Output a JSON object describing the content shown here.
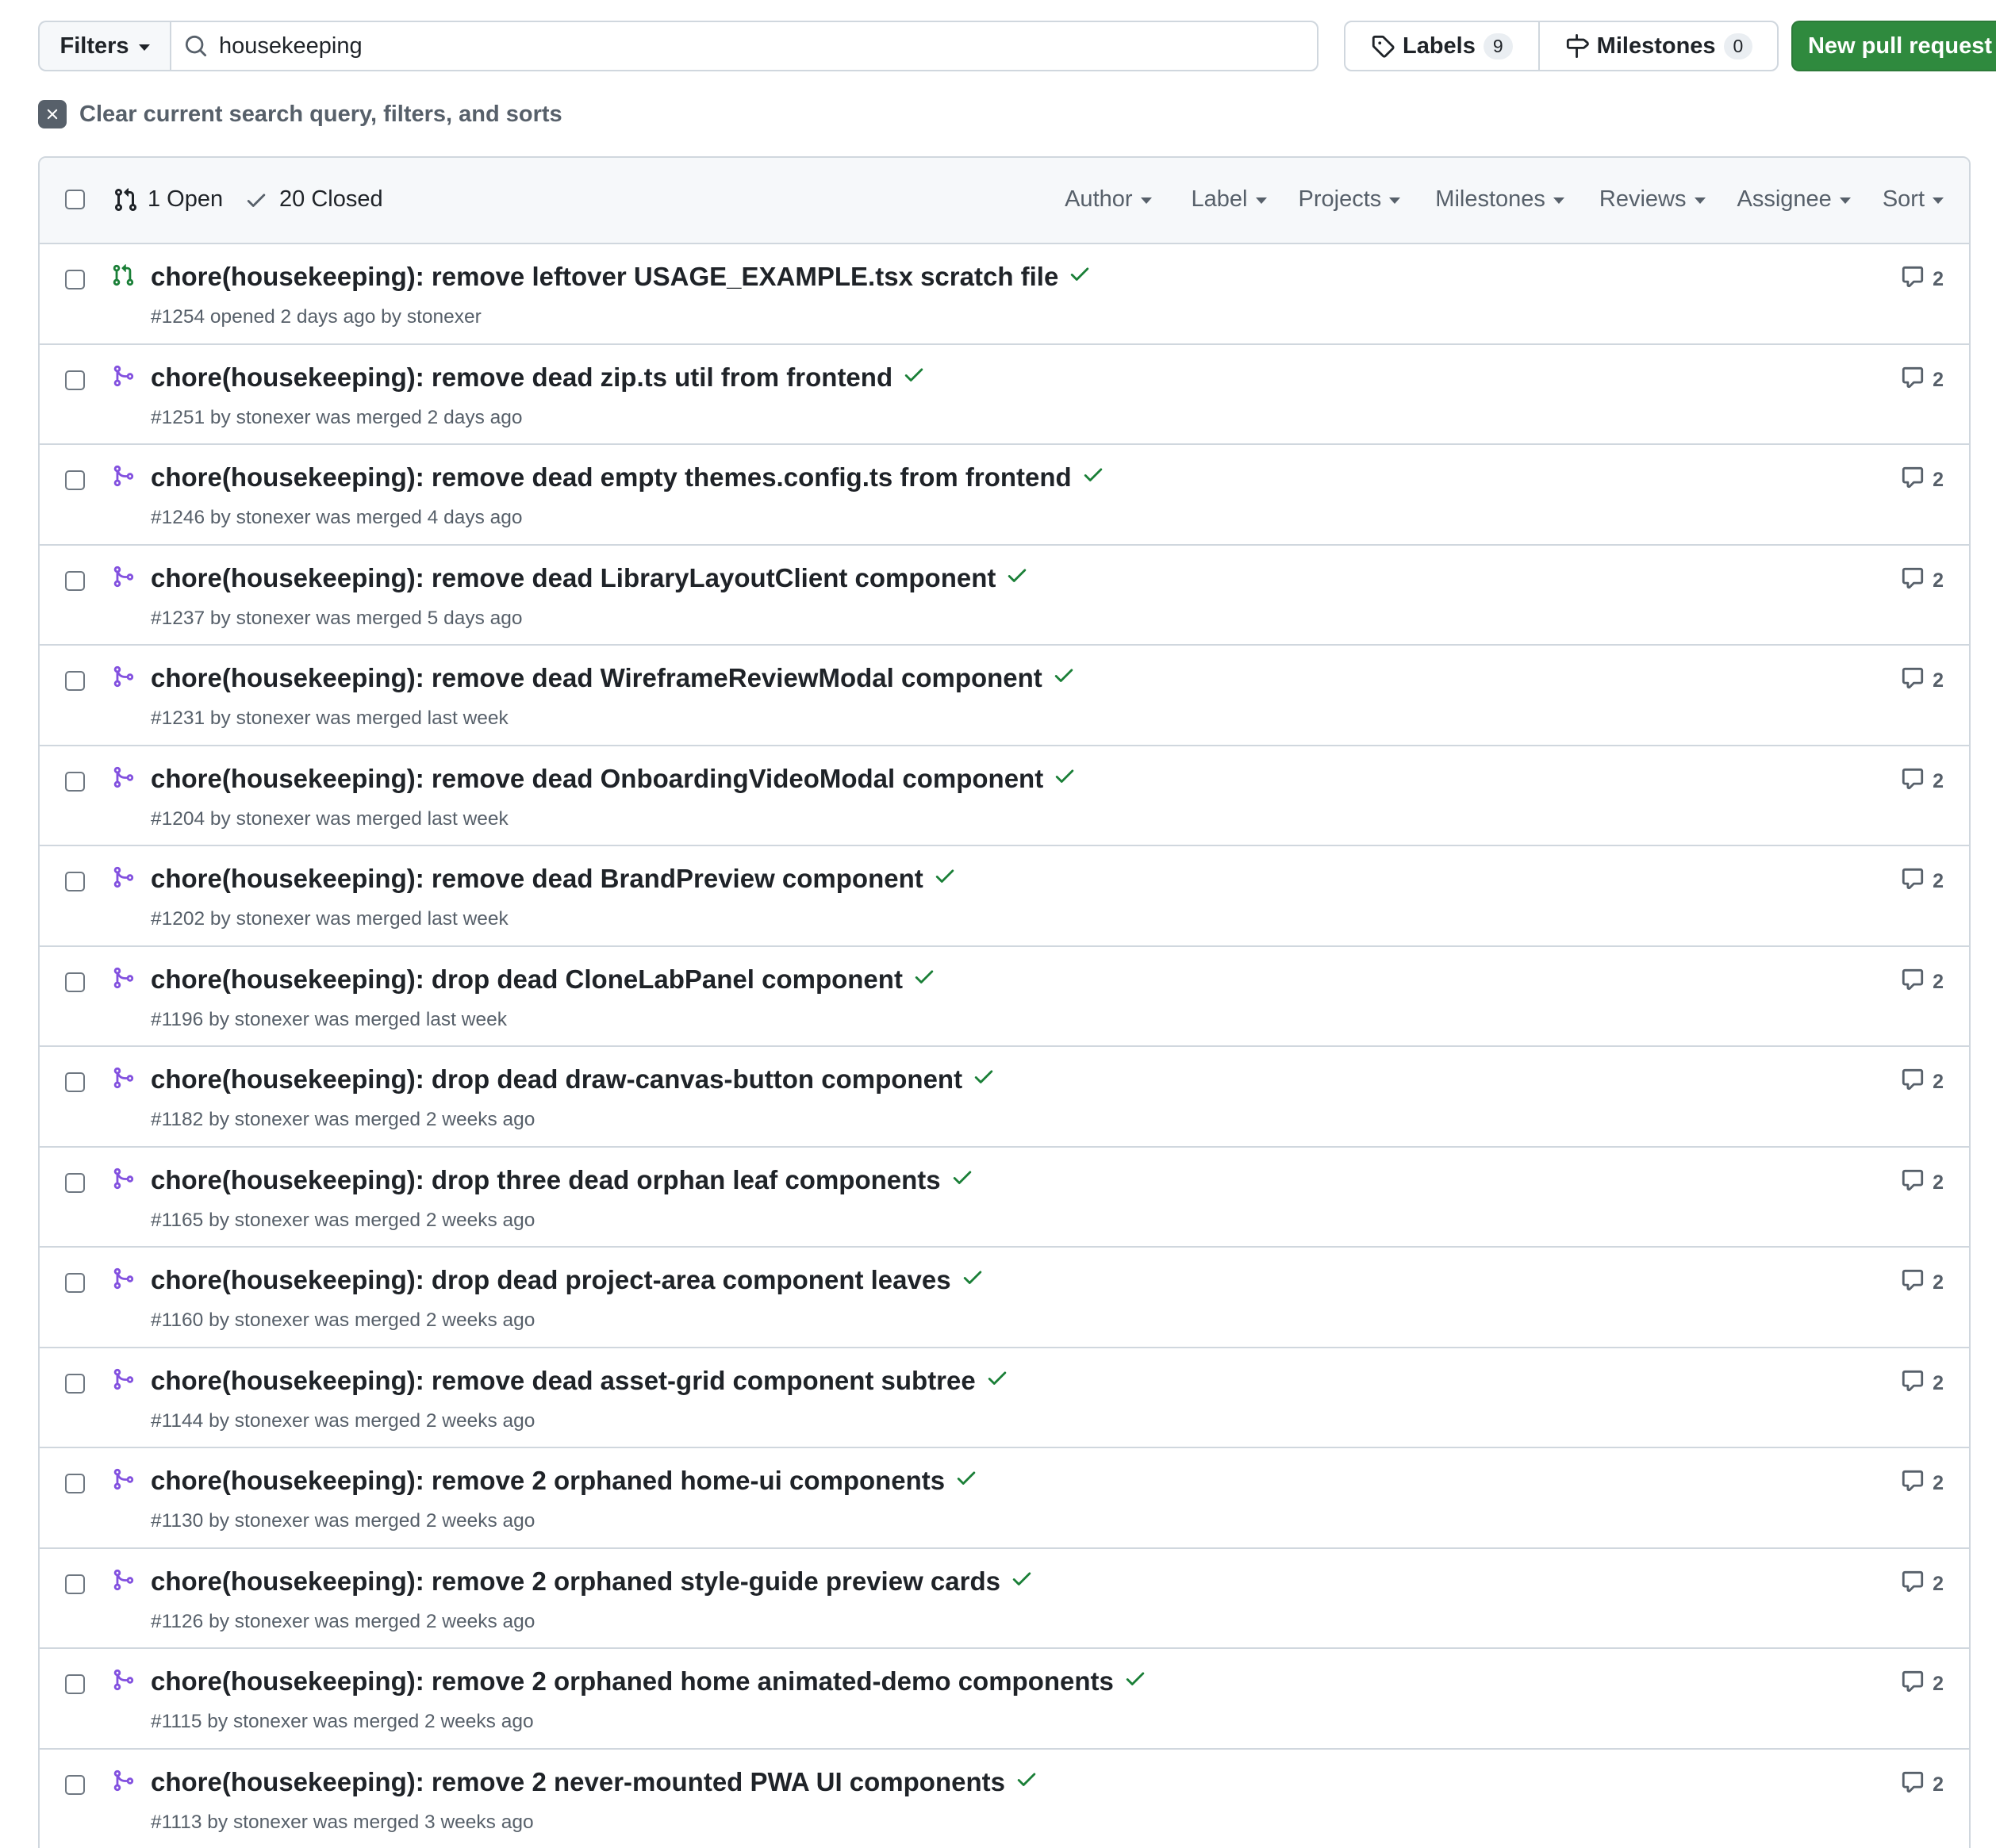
{
  "toolbar": {
    "filters_label": "Filters",
    "search_value": "housekeeping",
    "labels_label": "Labels",
    "labels_count": "9",
    "milestones_label": "Milestones",
    "milestones_count": "0",
    "new_pr_label": "New pull request"
  },
  "clear_text": "Clear current search query, filters, and sorts",
  "header": {
    "open_label": "1 Open",
    "closed_label": "20 Closed",
    "menus": [
      "Author",
      "Label",
      "Projects",
      "Milestones",
      "Reviews",
      "Assignee",
      "Sort"
    ]
  },
  "colors": {
    "open": "#1a7f37",
    "merged": "#8250df",
    "check": "#1a7f37",
    "button": "#2f8a3e"
  },
  "rows": [
    {
      "state": "open",
      "title": "chore(housekeeping): remove leftover USAGE_EXAMPLE.tsx scratch file",
      "meta": "#1254 opened 2 days ago by stonexer",
      "comments": "2"
    },
    {
      "state": "merged",
      "title": "chore(housekeeping): remove dead zip.ts util from frontend",
      "meta": "#1251 by stonexer was merged 2 days ago",
      "comments": "2"
    },
    {
      "state": "merged",
      "title": "chore(housekeeping): remove dead empty themes.config.ts from frontend",
      "meta": "#1246 by stonexer was merged 4 days ago",
      "comments": "2"
    },
    {
      "state": "merged",
      "title": "chore(housekeeping): remove dead LibraryLayoutClient component",
      "meta": "#1237 by stonexer was merged 5 days ago",
      "comments": "2"
    },
    {
      "state": "merged",
      "title": "chore(housekeeping): remove dead WireframeReviewModal component",
      "meta": "#1231 by stonexer was merged last week",
      "comments": "2"
    },
    {
      "state": "merged",
      "title": "chore(housekeeping): remove dead OnboardingVideoModal component",
      "meta": "#1204 by stonexer was merged last week",
      "comments": "2"
    },
    {
      "state": "merged",
      "title": "chore(housekeeping): remove dead BrandPreview component",
      "meta": "#1202 by stonexer was merged last week",
      "comments": "2"
    },
    {
      "state": "merged",
      "title": "chore(housekeeping): drop dead CloneLabPanel component",
      "meta": "#1196 by stonexer was merged last week",
      "comments": "2"
    },
    {
      "state": "merged",
      "title": "chore(housekeeping): drop dead draw-canvas-button component",
      "meta": "#1182 by stonexer was merged 2 weeks ago",
      "comments": "2"
    },
    {
      "state": "merged",
      "title": "chore(housekeeping): drop three dead orphan leaf components",
      "meta": "#1165 by stonexer was merged 2 weeks ago",
      "comments": "2"
    },
    {
      "state": "merged",
      "title": "chore(housekeeping): drop dead project-area component leaves",
      "meta": "#1160 by stonexer was merged 2 weeks ago",
      "comments": "2"
    },
    {
      "state": "merged",
      "title": "chore(housekeeping): remove dead asset-grid component subtree",
      "meta": "#1144 by stonexer was merged 2 weeks ago",
      "comments": "2"
    },
    {
      "state": "merged",
      "title": "chore(housekeeping): remove 2 orphaned home-ui components",
      "meta": "#1130 by stonexer was merged 2 weeks ago",
      "comments": "2"
    },
    {
      "state": "merged",
      "title": "chore(housekeeping): remove 2 orphaned style-guide preview cards",
      "meta": "#1126 by stonexer was merged 2 weeks ago",
      "comments": "2"
    },
    {
      "state": "merged",
      "title": "chore(housekeeping): remove 2 orphaned home animated-demo components",
      "meta": "#1115 by stonexer was merged 2 weeks ago",
      "comments": "2"
    },
    {
      "state": "merged",
      "title": "chore(housekeeping): remove 2 never-mounted PWA UI components",
      "meta": "#1113 by stonexer was merged 3 weeks ago",
      "comments": "2"
    }
  ]
}
